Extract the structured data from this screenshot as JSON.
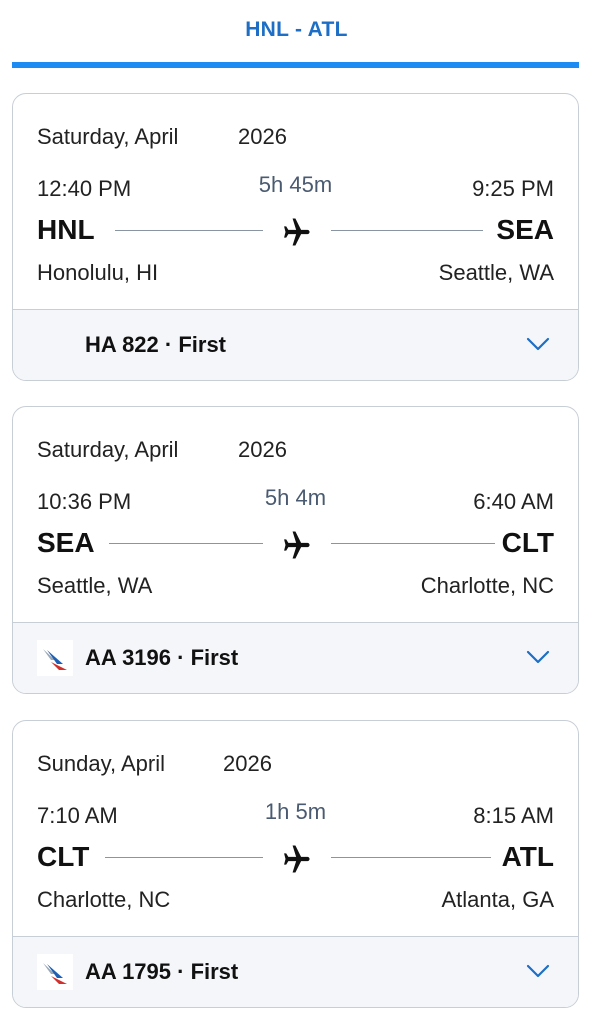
{
  "header": {
    "route_title": "HNL - ATL"
  },
  "segments": [
    {
      "date": "Saturday, April",
      "year": "2026",
      "dep_time": "12:40 PM",
      "duration": "5h 45m",
      "arr_time": "9:25 PM",
      "dep_code": "HNL",
      "arr_code": "SEA",
      "dep_city": "Honolulu, HI",
      "arr_city": "Seattle, WA",
      "flight": "HA 822 · First",
      "airline_logo": "none"
    },
    {
      "date": "Saturday, April",
      "year": "2026",
      "dep_time": "10:36 PM",
      "duration": "5h 4m",
      "arr_time": "6:40 AM",
      "dep_code": "SEA",
      "arr_code": "CLT",
      "dep_city": "Seattle, WA",
      "arr_city": "Charlotte, NC",
      "flight": "AA 3196 · First",
      "airline_logo": "american-airlines-logo"
    },
    {
      "date": "Sunday, April",
      "year": "2026",
      "dep_time": "7:10 AM",
      "duration": "1h 5m",
      "arr_time": "8:15 AM",
      "dep_code": "CLT",
      "arr_code": "ATL",
      "dep_city": "Charlotte, NC",
      "arr_city": "Atlanta, GA",
      "flight": "AA 1795 · First",
      "airline_logo": "american-airlines-logo"
    }
  ],
  "colors": {
    "accent": "#1d6ec4",
    "underline": "#1d8cf2",
    "border": "#c8ced6",
    "footer_bg": "#f4f6f9"
  },
  "icons": {
    "plane": "airplane-icon",
    "expand": "chevron-down-icon"
  }
}
